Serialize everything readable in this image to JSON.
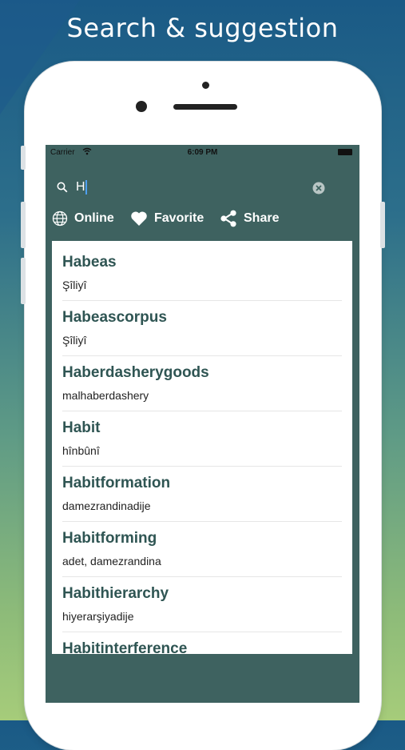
{
  "promo_title": "Search & suggestion",
  "status_bar": {
    "carrier": "Carrier",
    "time": "6:09 PM"
  },
  "search": {
    "value": "H"
  },
  "actions": {
    "online": "Online",
    "favorite": "Favorite",
    "share": "Share"
  },
  "results": [
    {
      "term": "Habeas",
      "translation": "Şîliyî"
    },
    {
      "term": "Habeascorpus",
      "translation": "Şîliyî"
    },
    {
      "term": "Haberdasherygoods",
      "translation": "malhaberdashery"
    },
    {
      "term": "Habit",
      "translation": "hînbûnî"
    },
    {
      "term": "Habitformation",
      "translation": "damezrandinadije"
    },
    {
      "term": "Habitforming",
      "translation": "adet, damezrandina"
    },
    {
      "term": "Habithierarchy",
      "translation": "hiyerarşiyadije"
    },
    {
      "term": "Habitinterference",
      "translation": ""
    }
  ],
  "colors": {
    "header_bg": "#3e6260",
    "term_text": "#2f5553",
    "background_top": "#1a5a86",
    "background_bottom": "#a6cc7a"
  }
}
